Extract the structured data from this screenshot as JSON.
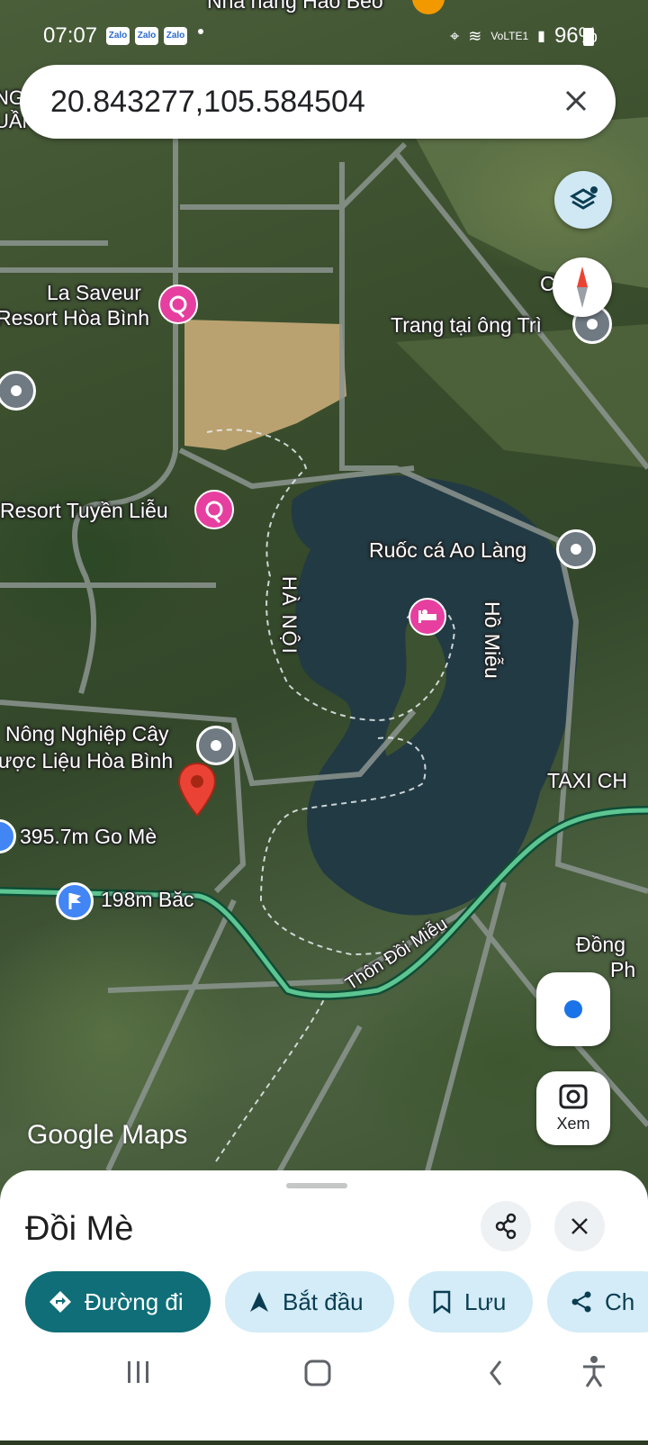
{
  "status_bar": {
    "time": "07:07",
    "zalo_icons": [
      "Zalo",
      "Zalo",
      "Zalo"
    ],
    "network": "VoLTE1",
    "battery": "96%"
  },
  "search": {
    "value": "20.843277,105.584504"
  },
  "map": {
    "partial_top_label": "Nhà hàng Hảo Béo",
    "places": [
      {
        "id": "la-saveur",
        "label_line1": "La Saveur",
        "label_line2": "Resort Hòa Bình",
        "type": "resort"
      },
      {
        "id": "trang-ong-tri",
        "label": "Trang tại ông Trì",
        "type": "generic"
      },
      {
        "id": "resort-tuyen-lieu",
        "label": "Resort Tuyền Liễu",
        "type": "resort"
      },
      {
        "id": "ruoc-ca",
        "label": "Ruốc cá Ao Làng",
        "type": "generic"
      },
      {
        "id": "nong-nghiep",
        "label_line1": "Nông Nghiệp Cây",
        "label_line2": "ược Liệu Hòa Bình",
        "type": "generic"
      },
      {
        "id": "go-me",
        "label": "395.7m Go Mè",
        "type": "generic"
      },
      {
        "id": "bac",
        "label": "198m Băc",
        "type": "flag"
      },
      {
        "id": "taxi",
        "label": "TAXI CH",
        "type": "generic"
      },
      {
        "id": "dong-ph",
        "label_line1": "Đồng",
        "label_line2": "Ph",
        "type": "generic"
      }
    ],
    "area_labels": {
      "ha_noi": "HÀ NỘI",
      "ho_mieu": "Hồ Miễu",
      "road": "Thôn Đồi Miễu"
    },
    "partial_labels": {
      "left_top": "NG\nUẦN",
      "right_top": "C     vị"
    },
    "watermark": "Google Maps",
    "lens_label": "Xem",
    "route_color": "#1e8e5a"
  },
  "place_card": {
    "name": "Đồi Mè",
    "actions": {
      "directions": "Đường đi",
      "start": "Bắt đầu",
      "save": "Lưu",
      "share": "Ch"
    }
  }
}
